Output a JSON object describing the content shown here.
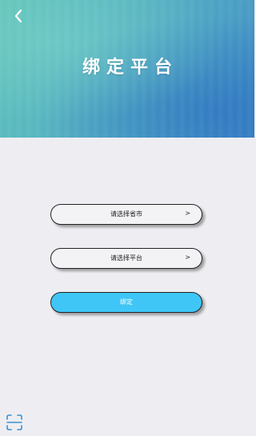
{
  "header": {
    "title": "绑定平台",
    "back_icon": "chevron-left-icon"
  },
  "form": {
    "province_select_label": "请选择省市",
    "province_select_arrow": ">",
    "platform_select_label": "请选择平台",
    "platform_select_arrow": ">",
    "bind_button_label": "绑定"
  },
  "footer": {
    "scan_icon": "scan-icon"
  },
  "colors": {
    "accent": "#3fc6f7",
    "background": "#eeeef2",
    "header_gradient_start": "#5fc3b8",
    "header_gradient_end": "#3b86c6"
  }
}
